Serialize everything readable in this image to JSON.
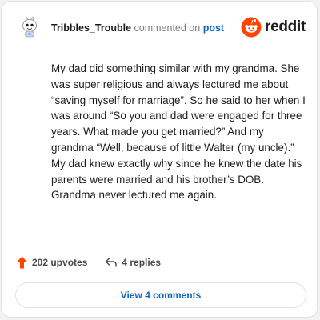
{
  "header": {
    "username": "Tribbles_Trouble",
    "action_text": "commented on",
    "post_link": "post"
  },
  "brand": {
    "name": "reddit",
    "icon": "reddit-logo-icon",
    "color": "#ff4500"
  },
  "comment": {
    "body": "My dad did something similar with my grandma. She was super religious and always lectured me about “saving myself for marriage”. So he said to her when I was around “So you and dad were engaged for three years. What made you get married?” And my grandma “Well, because of little Walter (my uncle).” My dad knew exactly why since he knew the date his parents were married and his brother’s DOB. Grandma never lectured me again."
  },
  "actions": {
    "upvotes_label": "202 upvotes",
    "upvote_icon": "upvote-arrow-icon",
    "upvote_color": "#ff4500",
    "replies_label": "4 replies",
    "reply_icon": "reply-arrow-icon"
  },
  "view_comments_label": "View 4 comments",
  "colors": {
    "link": "#0a66c2",
    "text": "#1c1c1c",
    "muted": "#7c7c7c"
  }
}
